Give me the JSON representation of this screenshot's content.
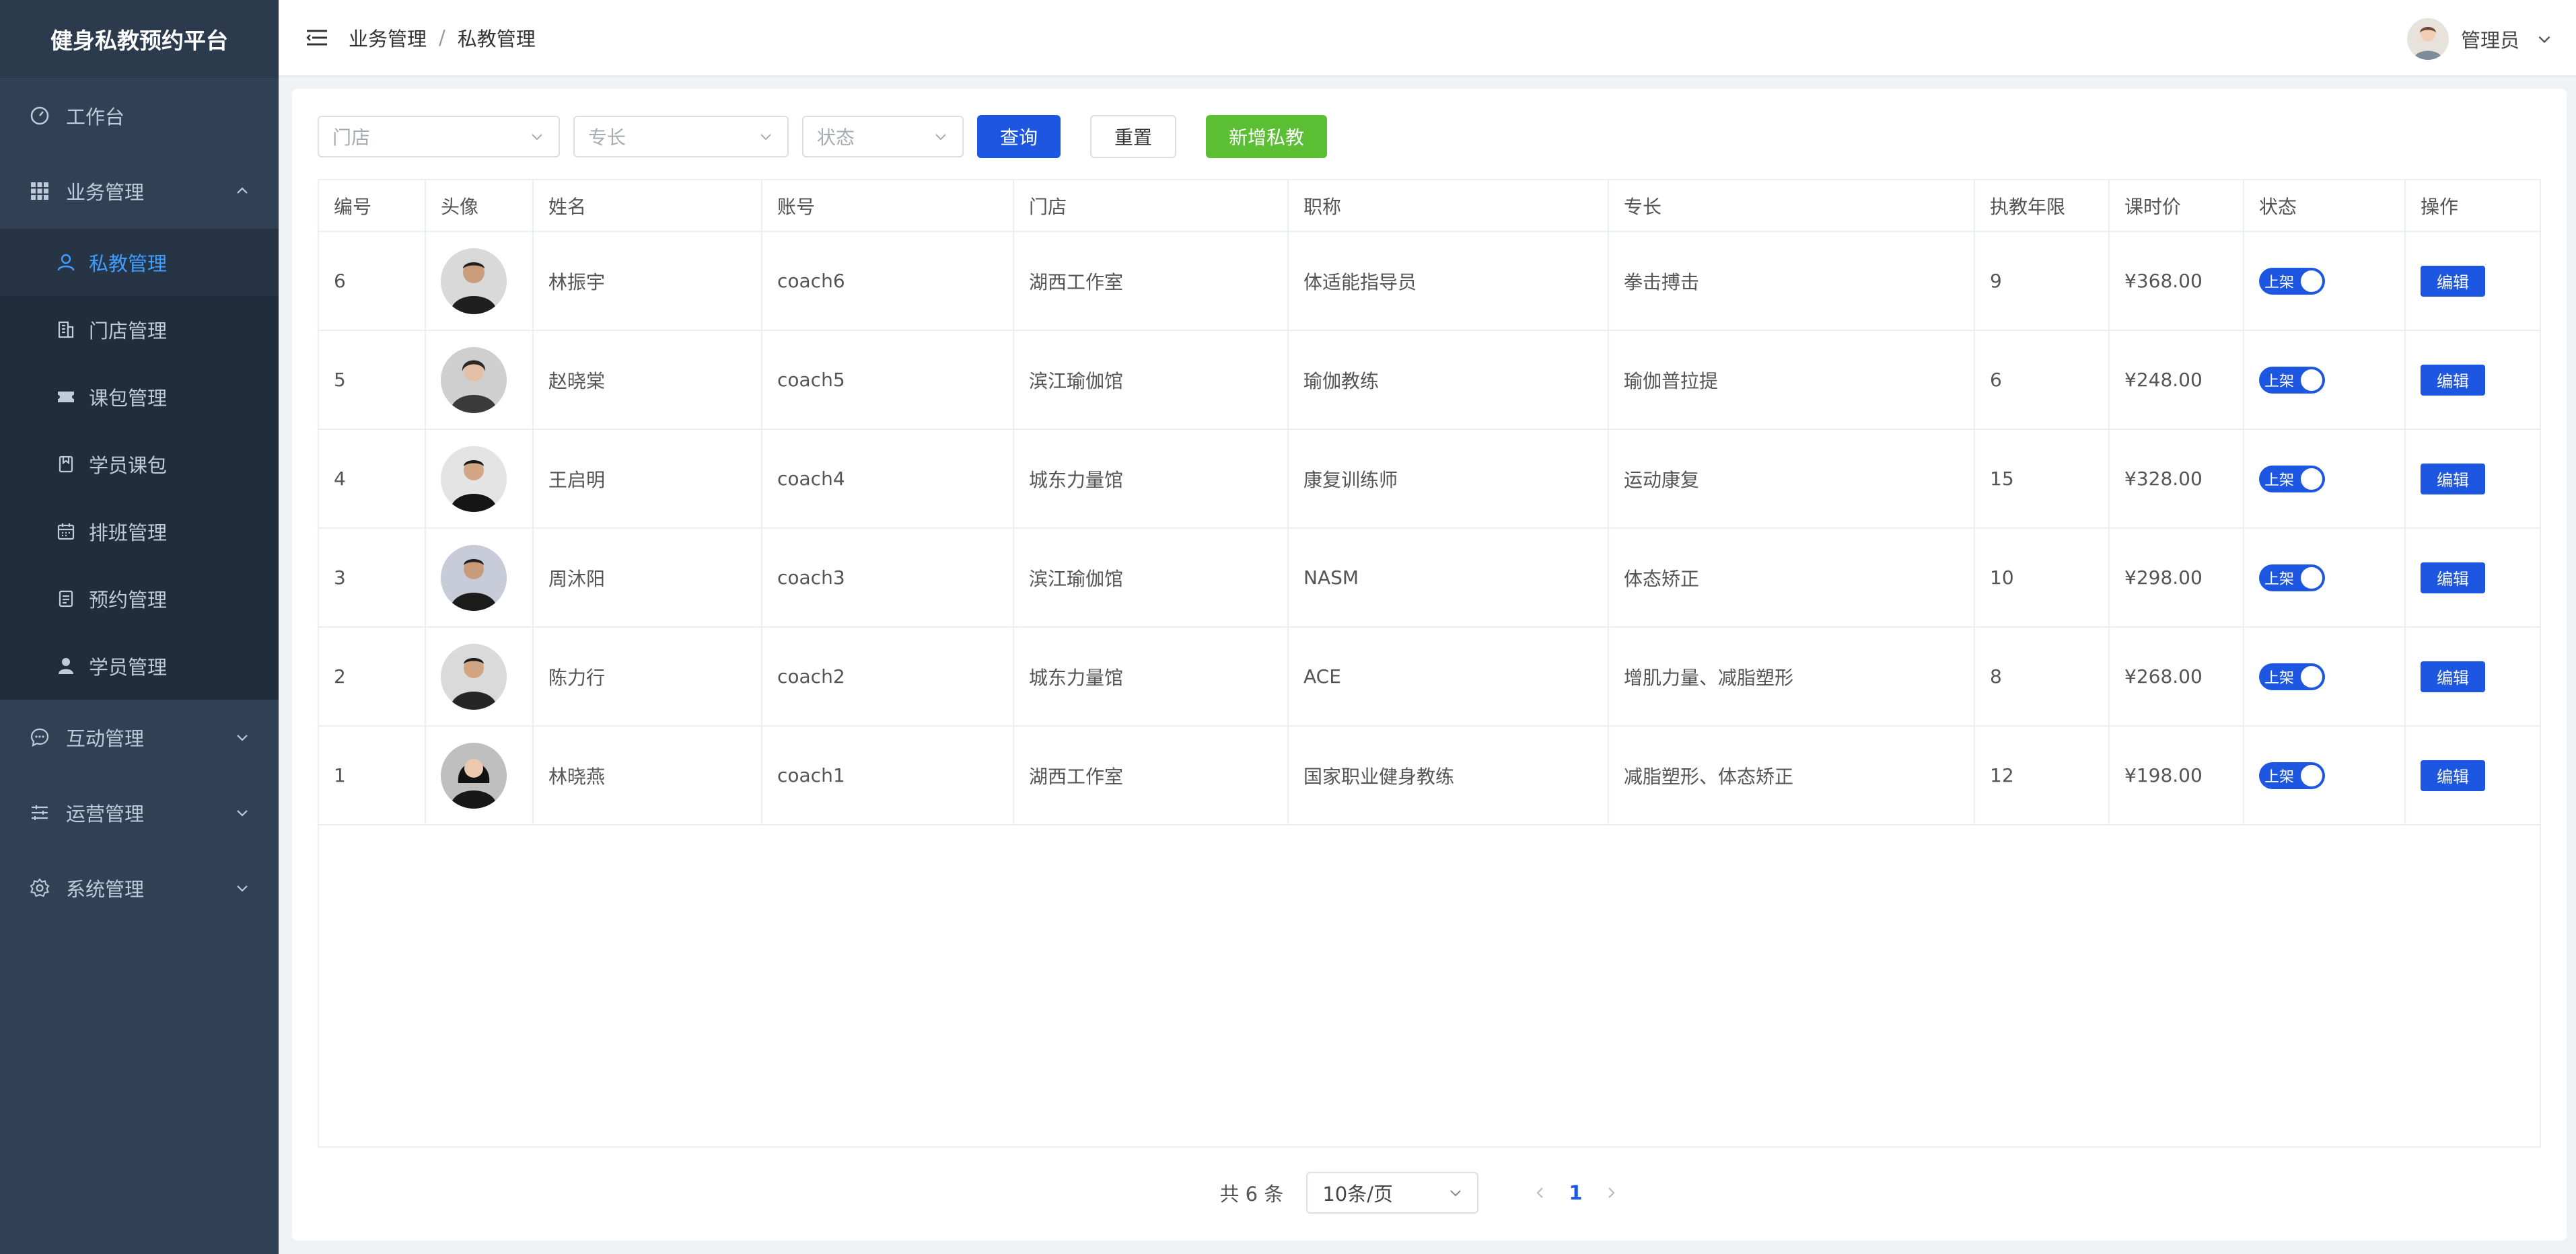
{
  "sidebar": {
    "brand": "健身私教预约平台",
    "items": [
      {
        "label": "工作台"
      },
      {
        "label": "业务管理"
      },
      {
        "label": "互动管理"
      },
      {
        "label": "运营管理"
      },
      {
        "label": "系统管理"
      }
    ],
    "sub": [
      {
        "label": "私教管理"
      },
      {
        "label": "门店管理"
      },
      {
        "label": "课包管理"
      },
      {
        "label": "学员课包"
      },
      {
        "label": "排班管理"
      },
      {
        "label": "预约管理"
      },
      {
        "label": "学员管理"
      }
    ]
  },
  "topbar": {
    "crumb1": "业务管理",
    "sep": "/",
    "crumb2": "私教管理",
    "user": "管理员"
  },
  "filters": {
    "store": "门店",
    "specialty": "专长",
    "status": "状态",
    "query": "查询",
    "reset": "重置",
    "add": "新增私教"
  },
  "table": {
    "headers": [
      "编号",
      "头像",
      "姓名",
      "账号",
      "门店",
      "职称",
      "专长",
      "执教年限",
      "课时价",
      "状态",
      "操作"
    ],
    "status_label": "上架",
    "edit_label": "编辑",
    "rows": [
      {
        "id": "6",
        "name": "林振宇",
        "account": "coach6",
        "store": "湖西工作室",
        "title": "体适能指导员",
        "specialty": "拳击搏击",
        "years": "9",
        "price": "¥368.00"
      },
      {
        "id": "5",
        "name": "赵晓棠",
        "account": "coach5",
        "store": "滨江瑜伽馆",
        "title": "瑜伽教练",
        "specialty": "瑜伽普拉提",
        "years": "6",
        "price": "¥248.00"
      },
      {
        "id": "4",
        "name": "王启明",
        "account": "coach4",
        "store": "城东力量馆",
        "title": "康复训练师",
        "specialty": "运动康复",
        "years": "15",
        "price": "¥328.00"
      },
      {
        "id": "3",
        "name": "周沐阳",
        "account": "coach3",
        "store": "滨江瑜伽馆",
        "title": "NASM",
        "specialty": "体态矫正",
        "years": "10",
        "price": "¥298.00"
      },
      {
        "id": "2",
        "name": "陈力行",
        "account": "coach2",
        "store": "城东力量馆",
        "title": "ACE",
        "specialty": "增肌力量、减脂塑形",
        "years": "8",
        "price": "¥268.00"
      },
      {
        "id": "1",
        "name": "林晓燕",
        "account": "coach1",
        "store": "湖西工作室",
        "title": "国家职业健身教练",
        "specialty": "减脂塑形、体态矫正",
        "years": "12",
        "price": "¥198.00"
      }
    ]
  },
  "pagination": {
    "total": "共 6 条",
    "page_size": "10条/页",
    "current": "1"
  },
  "colors": {
    "sidebar_bg": "#304156",
    "active": "#409eff",
    "primary": "#1d56e0",
    "success": "#5bbf34"
  }
}
